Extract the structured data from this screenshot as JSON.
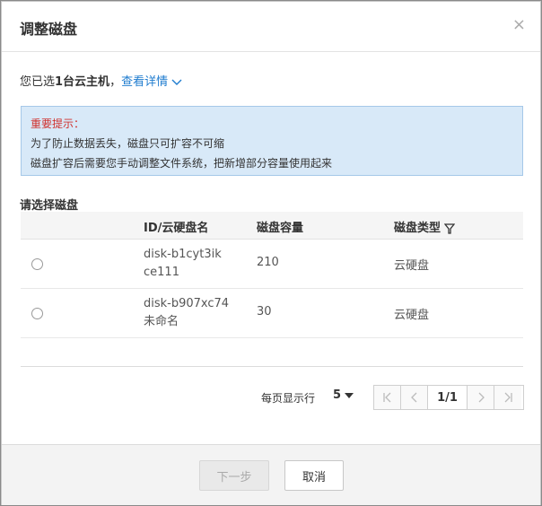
{
  "dialog": {
    "title": "调整磁盘",
    "close_label": "×"
  },
  "selection": {
    "prefix": "您已选",
    "count_text": "1台云主机",
    "comma": "，",
    "details_link": "查看详情"
  },
  "notice": {
    "title": "重要提示：",
    "line1": "为了防止数据丢失，磁盘只可扩容不可缩",
    "line2": "磁盘扩容后需要您手动调整文件系统，把新增部分容量使用起来"
  },
  "section_label": "请选择磁盘",
  "table": {
    "headers": {
      "id": "ID/云硬盘名",
      "capacity": "磁盘容量",
      "type": "磁盘类型"
    },
    "rows": [
      {
        "id": "disk-b1cyt3ik",
        "name": "ce111",
        "capacity": "210",
        "type": "云硬盘"
      },
      {
        "id": "disk-b907xc74",
        "name": "未命名",
        "capacity": "30",
        "type": "云硬盘"
      }
    ]
  },
  "pagination": {
    "per_page_label": "每页显示行",
    "page_size": "5",
    "page_indicator": "1/1"
  },
  "footer": {
    "next_label": "下一步",
    "cancel_label": "取消"
  },
  "colors": {
    "link": "#1f7ccf",
    "notice_bg": "#d8e9f8",
    "notice_title": "#d0302c"
  },
  "icons": [
    "close-icon",
    "chevron-down-icon",
    "filter-icon",
    "radio-icon",
    "first-page-icon",
    "prev-page-icon",
    "next-page-icon",
    "last-page-icon",
    "caret-down-icon"
  ]
}
